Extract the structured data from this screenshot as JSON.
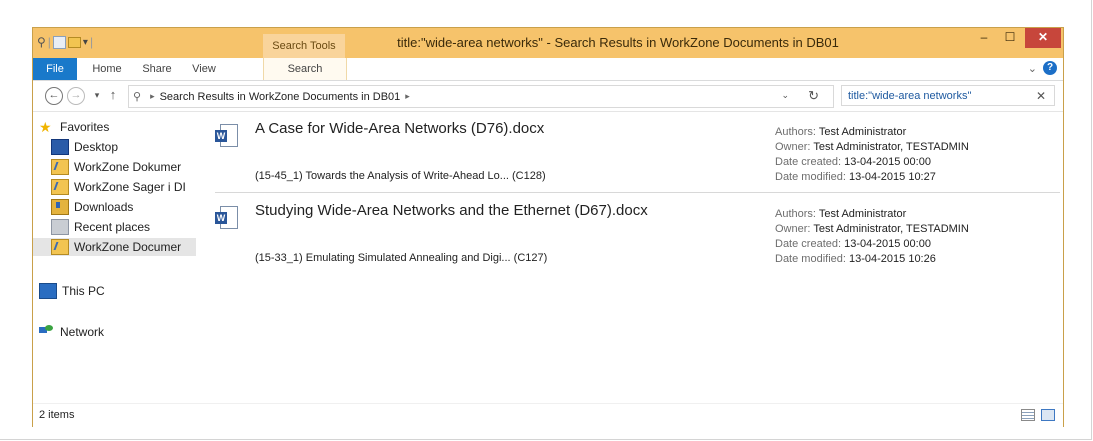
{
  "window": {
    "title": "title:\"wide-area networks\" - Search Results in WorkZone Documents in DB01",
    "contextual_tab_group": "Search Tools",
    "min_label": "–",
    "max_label": "☐",
    "close_label": "✕"
  },
  "ribbon": {
    "tabs": [
      "File",
      "Home",
      "Share",
      "View",
      "Search"
    ],
    "help": "?"
  },
  "address": {
    "path": "Search Results in WorkZone Documents in DB01",
    "search_value": "title:\"wide-area networks\""
  },
  "nav": {
    "favorites": "Favorites",
    "items": [
      "Desktop",
      "WorkZone Dokumer",
      "WorkZone Sager i DI",
      "Downloads",
      "Recent places",
      "WorkZone Documer"
    ],
    "this_pc": "This PC",
    "network": "Network"
  },
  "results": [
    {
      "title": "A Case for Wide-Area Networks (D76).docx",
      "subtitle": "(15-45_1) Towards the Analysis of Write-Ahead Lo... (C128)",
      "authors_label": "Authors:",
      "authors": "Test Administrator",
      "owner_label": "Owner:",
      "owner": "Test Administrator, TESTADMIN",
      "created_label": "Date created:",
      "created": "13-04-2015 00:00",
      "modified_label": "Date modified:",
      "modified": "13-04-2015 10:27"
    },
    {
      "title": "Studying Wide-Area Networks and the Ethernet (D67).docx",
      "subtitle": "(15-33_1) Emulating Simulated Annealing and Digi... (C127)",
      "authors_label": "Authors:",
      "authors": "Test Administrator",
      "owner_label": "Owner:",
      "owner": "Test Administrator, TESTADMIN",
      "created_label": "Date created:",
      "created": "13-04-2015 00:00",
      "modified_label": "Date modified:",
      "modified": "13-04-2015 10:26"
    }
  ],
  "status": {
    "count": "2 items"
  },
  "colors": {
    "titlebar": "#f6c36b",
    "file_tab": "#1979ca",
    "close_button": "#c7463b"
  }
}
